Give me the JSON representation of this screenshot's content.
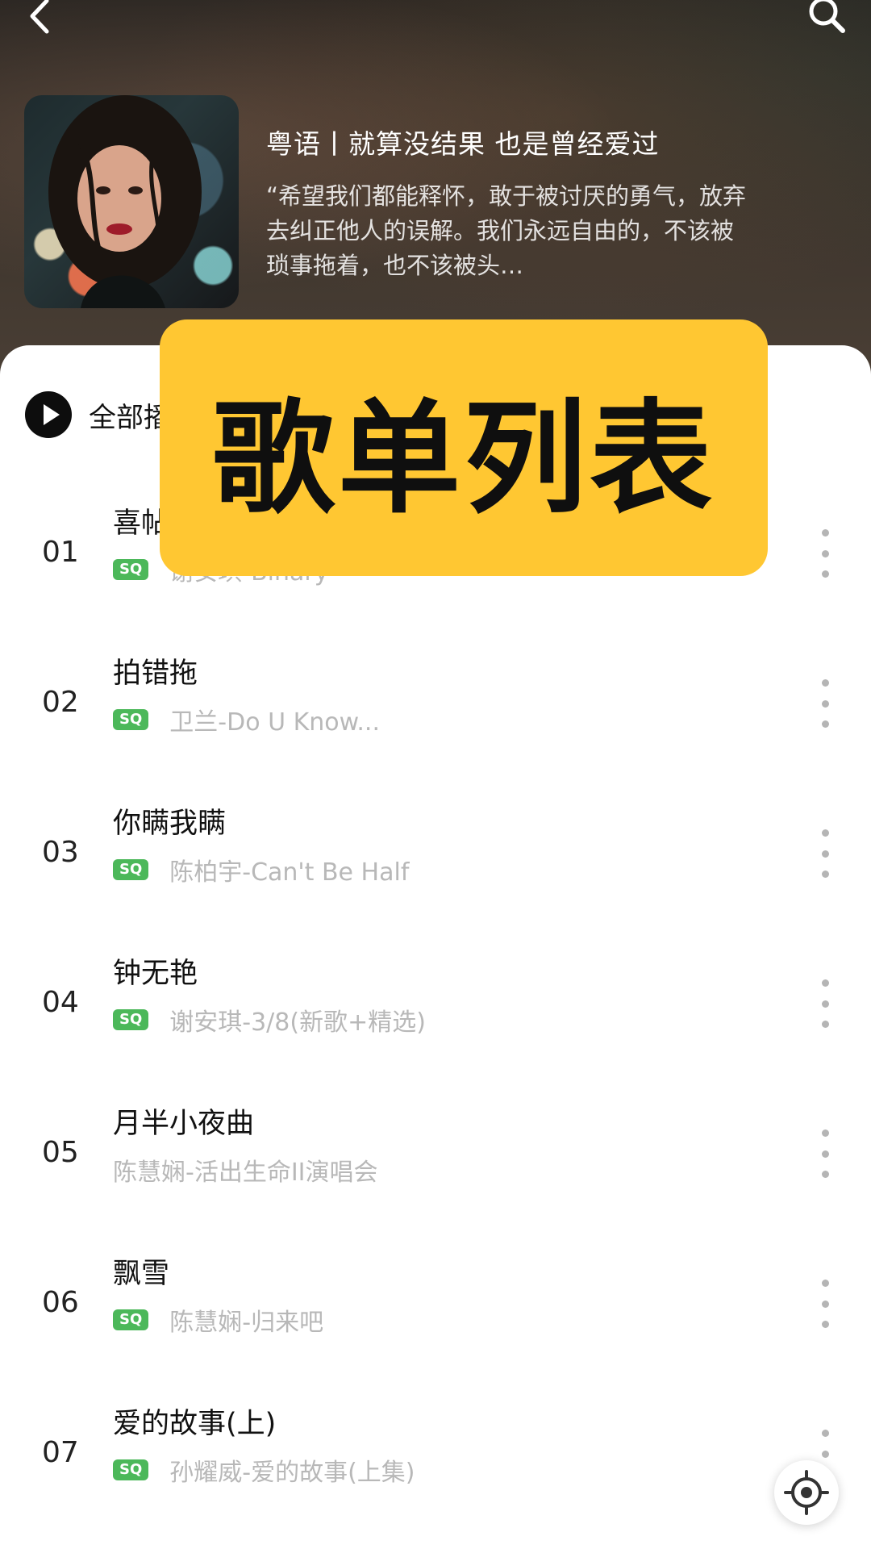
{
  "header": {
    "back_icon": "chevron-left-icon",
    "search_icon": "search-icon",
    "playlist_title": "粤语丨就算没结果 也是曾经爱过",
    "playlist_description": "“希望我们都能释怀，敢于被讨厌的勇气，放弃去纠正他人的误解。我们永远自由的，不该被琐事拖着，也不该被头…"
  },
  "list_header": {
    "play_all_label": "全部播放"
  },
  "banner": {
    "text": "歌单列表",
    "color": "#ffc732"
  },
  "songs": [
    {
      "index": "01",
      "title": "喜帖街",
      "sq": "SQ",
      "artist": "谢安琪-Binary"
    },
    {
      "index": "02",
      "title": "拍错拖",
      "sq": "SQ",
      "artist": "卫兰-Do U Know..."
    },
    {
      "index": "03",
      "title": "你瞒我瞒",
      "sq": "SQ",
      "artist": "陈柏宇-Can't Be Half"
    },
    {
      "index": "04",
      "title": "钟无艳",
      "sq": "SQ",
      "artist": "谢安琪-3/8(新歌+精选)"
    },
    {
      "index": "05",
      "title": "月半小夜曲",
      "sq": "",
      "artist": "陈慧娴-活出生命II演唱会"
    },
    {
      "index": "06",
      "title": "飘雪",
      "sq": "SQ",
      "artist": "陈慧娴-归来吧"
    },
    {
      "index": "07",
      "title": "爱的故事(上)",
      "sq": "SQ",
      "artist": "孙耀威-爱的故事(上集)"
    }
  ],
  "colors": {
    "sq_badge": "#4cb85a",
    "artist_text": "#b8b8b8"
  }
}
